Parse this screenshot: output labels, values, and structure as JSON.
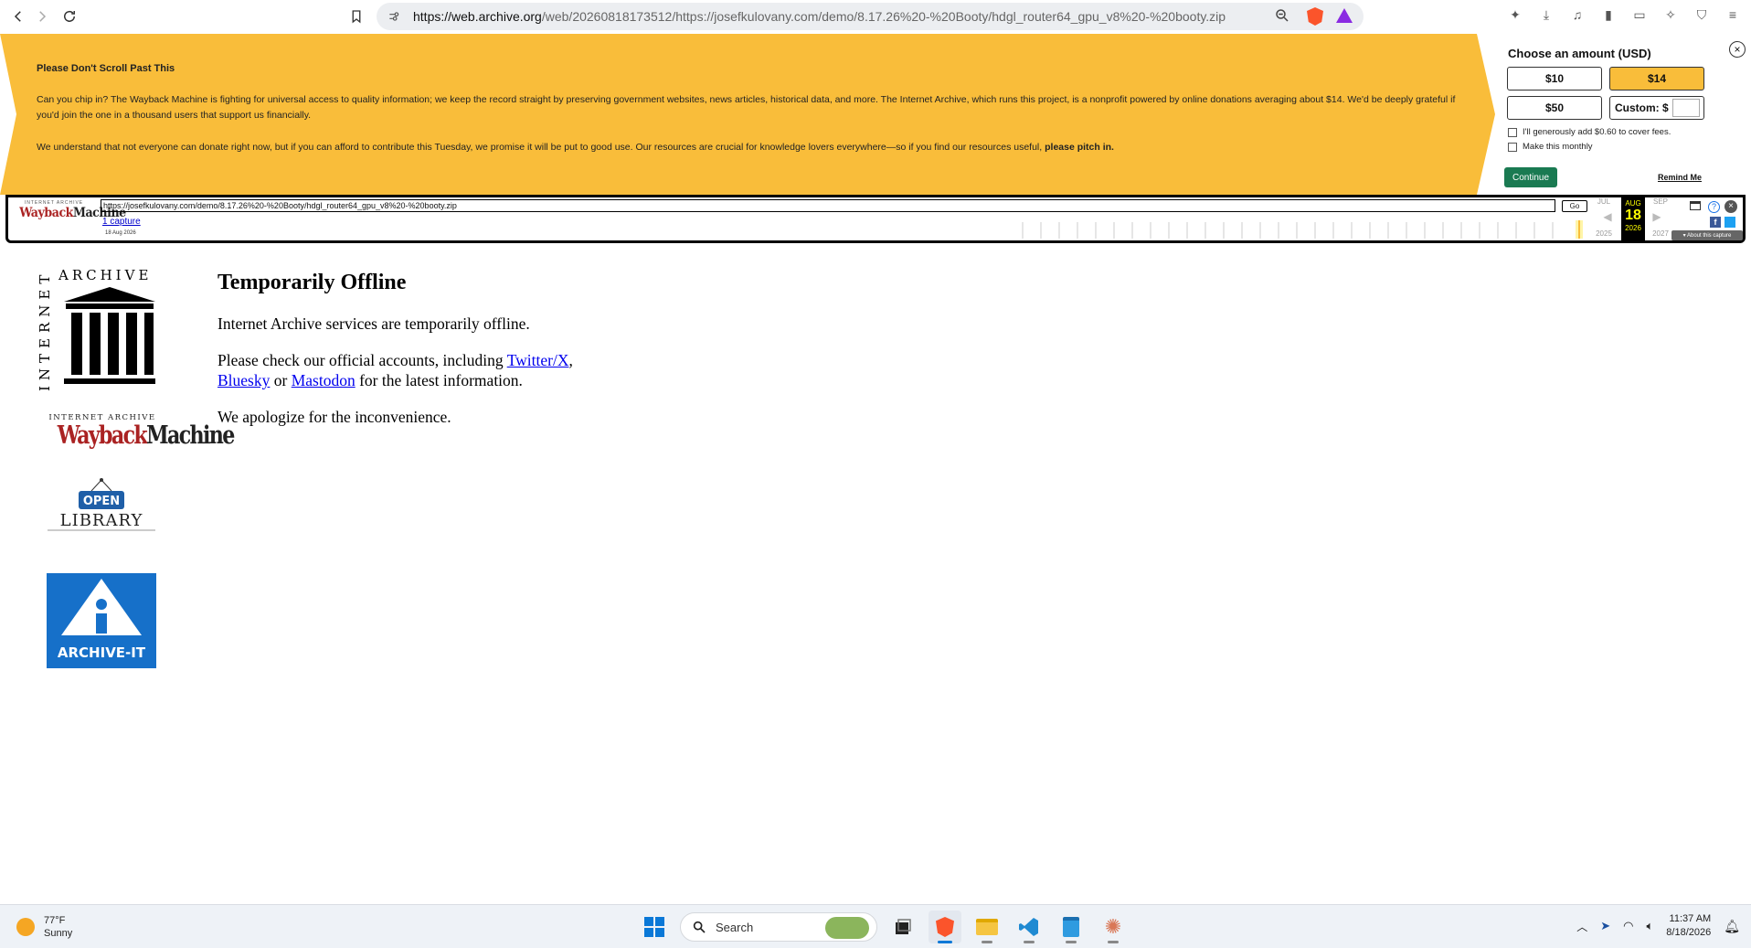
{
  "browser": {
    "url_host": "https://web.archive.org",
    "url_path": "/web/20260818173512/https://josefkulovany.com/demo/8.17.26%20-%20Booty/hdgl_router64_gpu_v8%20-%20booty.zip"
  },
  "banner": {
    "title": "Please Don't Scroll Past This",
    "p1": "Can you chip in? The Wayback Machine is fighting for universal access to quality information; we keep the record straight by preserving government websites, news articles, historical data, and more. The Internet Archive, which runs this project, is a nonprofit powered by online donations averaging about $14. We'd be deeply grateful if you'd join the one in a thousand users that support us financially.",
    "p2_main": "We understand that not everyone can donate right now, but if you can afford to contribute this Tuesday, we promise it will be put to good use. Our resources are crucial for knowledge lovers everywhere—so if you find our resources useful, ",
    "p2_bold": "please pitch in.",
    "choose_label": "Choose an amount (USD)",
    "amounts": [
      "$10",
      "$14",
      "$50"
    ],
    "custom_label": "Custom: $",
    "check_fees": "I'll generously add $0.60 to cover fees.",
    "check_monthly": "Make this monthly",
    "continue": "Continue",
    "remind": "Remind Me",
    "close": "×",
    "accent": "#f9bd3a"
  },
  "wayback": {
    "logo_top": "INTERNET ARCHIVE",
    "logo_wb": "Wayback",
    "logo_m": "Machine",
    "url_value": "https://josefkulovany.com/demo/8.17.26%20-%20Booty/hdgl_router64_gpu_v8%20-%20booty.zip",
    "go": "Go",
    "captures": "1 capture",
    "capture_date": "18 Aug 2026",
    "prev_month": "JUL",
    "cur_month": "AUG",
    "next_month": "SEP",
    "cur_day": "18",
    "prev_year": "2025",
    "cur_year": "2026",
    "next_year": "2027",
    "about": "▾ About this capture"
  },
  "page": {
    "ia_letters": "ARCHIVE",
    "ia_side": "INTERNET",
    "wbm_top": "INTERNET ARCHIVE",
    "wbm_wb": "Wayback",
    "wbm_m": "Machine",
    "ol_open": "OPEN",
    "ol_library": "LIBRARY",
    "ai_label": "ARCHIVE-IT",
    "heading": "Temporarily Offline",
    "p1": "Internet Archive services are temporarily offline.",
    "p2_before": "Please check our official accounts, including ",
    "link_twitter": "Twitter/X",
    "sep1": ", ",
    "link_bluesky": "Bluesky",
    "sep2": " or ",
    "link_mastodon": "Mastodon",
    "p2_after": " for the latest information.",
    "p3": "We apologize for the inconvenience."
  },
  "taskbar": {
    "temp": "77°F",
    "condition": "Sunny",
    "search_placeholder": "Search",
    "time": "11:37 AM",
    "date": "8/18/2026"
  }
}
